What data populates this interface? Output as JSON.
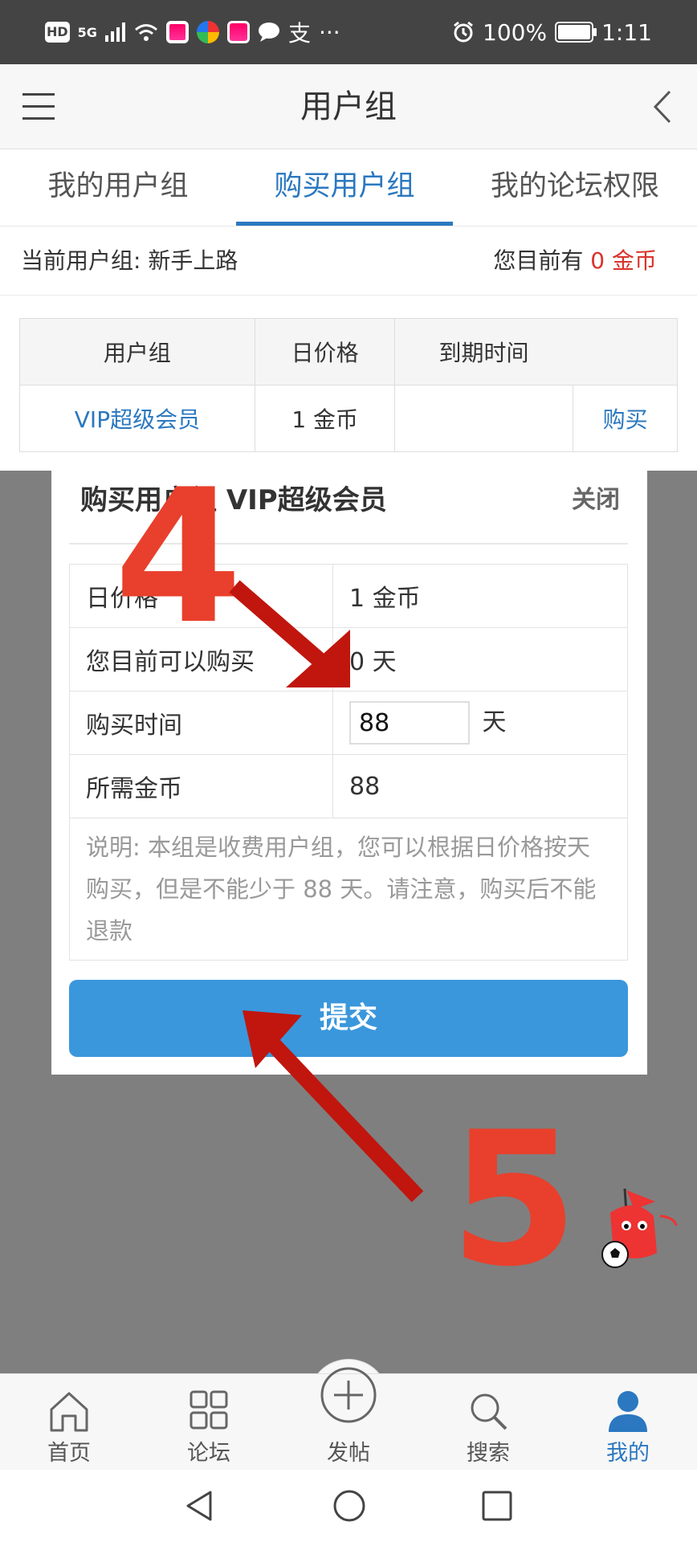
{
  "status_bar": {
    "left_icons": [
      "HD",
      "5G"
    ],
    "battery": "100%",
    "time": "1:11",
    "more": "···",
    "pay_icon": "支"
  },
  "header": {
    "title": "用户组",
    "menu_icon": "hamburger-icon",
    "back_icon": "chevron-left-icon"
  },
  "tabs": [
    {
      "label": "我的用户组",
      "active": false
    },
    {
      "label": "购买用户组",
      "active": true
    },
    {
      "label": "我的论坛权限",
      "active": false
    }
  ],
  "info": {
    "current_group_label": "当前用户组: 新手上路",
    "coins_prefix": "您目前有",
    "coins_value": "0",
    "coins_unit": "金币"
  },
  "group_table": {
    "headers": [
      "用户组",
      "日价格",
      "到期时间"
    ],
    "rows": [
      {
        "name": "VIP超级会员",
        "price": "1 金币",
        "expiry": "",
        "action": "购买"
      }
    ]
  },
  "modal": {
    "title": "购买用户组 VIP超级会员",
    "close_label": "关闭",
    "rows": {
      "daily_price_label": "日价格",
      "daily_price_value": "1 金币",
      "can_buy_label": "您目前可以购买",
      "can_buy_value": "0 天",
      "buy_time_label": "购买时间",
      "buy_time_input": "88",
      "buy_time_unit": "天",
      "required_coins_label": "所需金币",
      "required_coins_value": "88"
    },
    "note": "说明: 本组是收费用户组，您可以根据日价格按天购买，但是不能少于 88 天。请注意，购买后不能退款",
    "submit_label": "提交"
  },
  "annotations": {
    "step_a": "4",
    "step_b": "5",
    "color": "#e8402c",
    "arrow_color": "#c0160e"
  },
  "bottom_nav": [
    {
      "label": "首页",
      "icon": "home-icon",
      "active": false
    },
    {
      "label": "论坛",
      "icon": "grid-icon",
      "active": false
    },
    {
      "label": "发帖",
      "icon": "plus-circle-icon",
      "active": false
    },
    {
      "label": "搜索",
      "icon": "search-icon",
      "active": false
    },
    {
      "label": "我的",
      "icon": "user-icon",
      "active": true
    }
  ],
  "colors": {
    "accent": "#2b78c0",
    "button": "#3a97dc",
    "warning": "#d9332b"
  }
}
